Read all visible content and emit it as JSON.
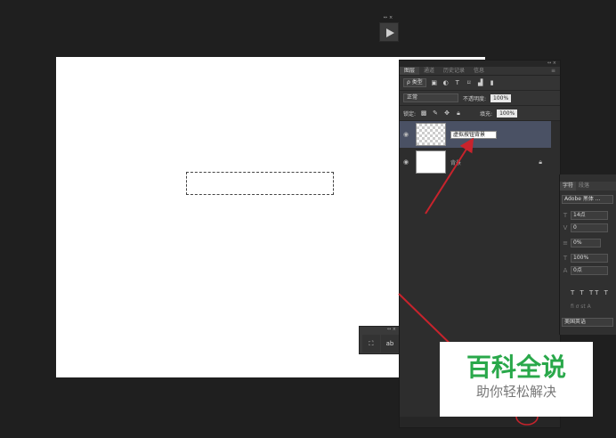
{
  "window_controls": {
    "double_arrow": "↔",
    "close": "×"
  },
  "layers_panel": {
    "tabs": [
      "图层",
      "通道",
      "历史记录",
      "信息"
    ],
    "filter_label": "ρ 类型",
    "blend_mode": "正常",
    "opacity_label": "不透明度:",
    "opacity_value": "100%",
    "lock_label": "锁定:",
    "fill_label": "填充:",
    "fill_value": "100%",
    "layers": [
      {
        "name": "虚拟按钮背景",
        "editing": true,
        "selected": true
      },
      {
        "name": "背景",
        "locked": true
      }
    ]
  },
  "character_panel": {
    "tabs": [
      "字符",
      "段落"
    ],
    "font": "Adobe 黑体 ...",
    "size": "14点",
    "kerning": "0",
    "tracking": "0%",
    "vscale": "100%",
    "baseline": "0点",
    "styles_row": "T T TT T",
    "lang": "美国英语"
  },
  "tool_panel": {
    "btn1_icon": "paint-bucket-icon",
    "btn2_label": "ab"
  },
  "watermark": {
    "title": "百科全说",
    "subtitle": "助你轻松解决"
  },
  "colors": {
    "arrow": "#c8232c",
    "watermark_green": "#29a84a",
    "selected_layer": "#4a5164"
  }
}
